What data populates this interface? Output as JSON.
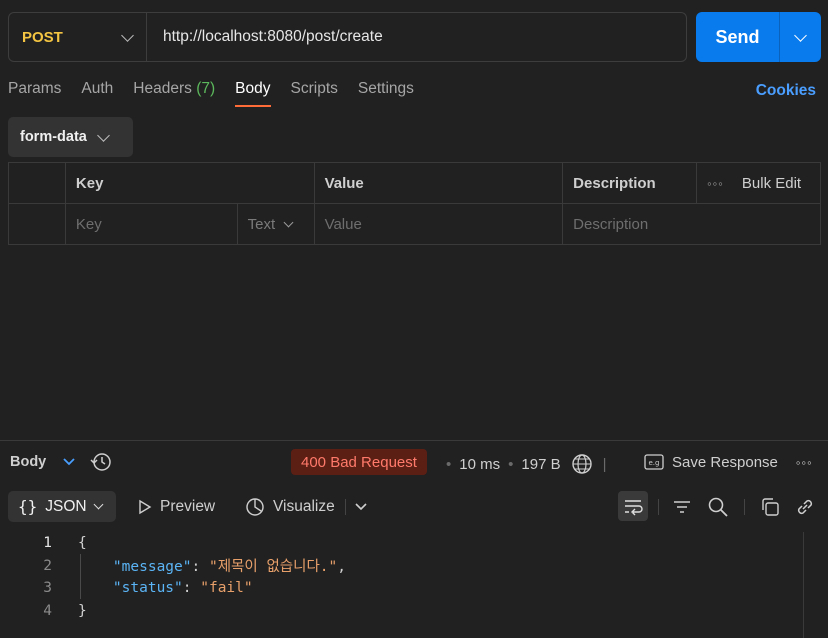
{
  "request": {
    "method": "POST",
    "url": "http://localhost:8080/post/create",
    "send_label": "Send"
  },
  "tabs": [
    {
      "label": "Params"
    },
    {
      "label": "Auth"
    },
    {
      "label": "Headers",
      "count": "(7)"
    },
    {
      "label": "Body",
      "active": true
    },
    {
      "label": "Scripts"
    },
    {
      "label": "Settings"
    }
  ],
  "cookies_label": "Cookies",
  "body_type": "form-data",
  "table": {
    "headers": {
      "key": "Key",
      "value": "Value",
      "description": "Description",
      "bulk_edit": "Bulk Edit"
    },
    "row": {
      "key_placeholder": "Key",
      "type": "Text",
      "value_placeholder": "Value",
      "description_placeholder": "Description"
    }
  },
  "response": {
    "title": "Body",
    "status": "400 Bad Request",
    "time": "10 ms",
    "size": "197 B",
    "save_label": "Save Response",
    "format": "JSON",
    "preview_label": "Preview",
    "visualize_label": "Visualize",
    "code_lines": [
      {
        "n": "1",
        "text": "{"
      },
      {
        "n": "2",
        "key": "\"message\"",
        "colon": ": ",
        "value": "\"제목이 없습니다.\"",
        "comma": ","
      },
      {
        "n": "3",
        "key": "\"status\"",
        "colon": ": ",
        "value": "\"fail\"",
        "comma": ""
      },
      {
        "n": "4",
        "text": "}"
      }
    ]
  },
  "colors": {
    "method": "#f4c542",
    "send": "#097bed",
    "active_tab_underline": "#ff6c37",
    "cookies": "#4a9eff",
    "status_bg": "#5c1f14",
    "status_text": "#ff7a6b",
    "json_key": "#5bb4f5",
    "json_string": "#e8a06a"
  }
}
